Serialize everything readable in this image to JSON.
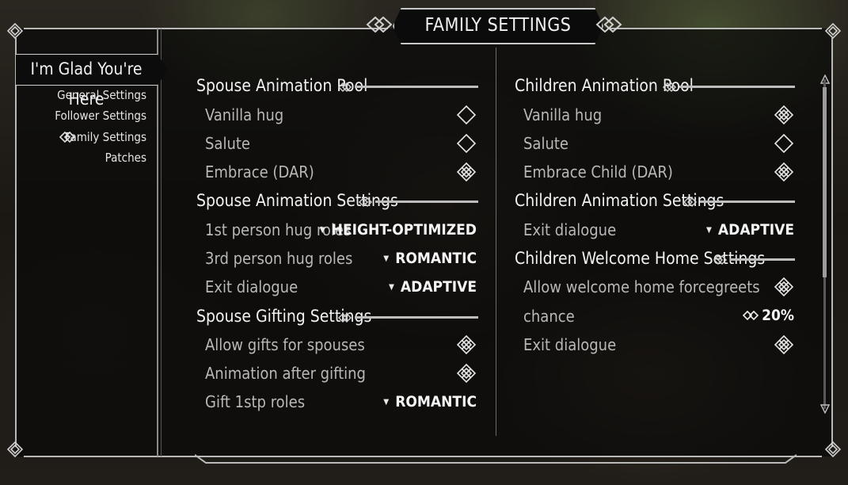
{
  "window": {
    "title": "FAMILY SETTINGS"
  },
  "sidebar": {
    "selected": "I'm Glad You're Here",
    "items": [
      {
        "label": "General Settings"
      },
      {
        "label": "Follower Settings"
      },
      {
        "label": "Family Settings",
        "icon": "celtic-knot-icon",
        "active": true
      },
      {
        "label": "Patches"
      }
    ]
  },
  "left": {
    "sections": [
      {
        "heading": "Spouse Animation Pool",
        "rows": [
          {
            "label": "Vanilla hug",
            "type": "toggle",
            "checked": false
          },
          {
            "label": "Salute",
            "type": "toggle",
            "checked": false
          },
          {
            "label": "Embrace (DAR)",
            "type": "toggle",
            "checked": true
          }
        ]
      },
      {
        "heading": "Spouse Animation Settings",
        "rows": [
          {
            "label": "1st person hug roles",
            "type": "menu",
            "value": "HEIGHT-OPTIMIZED"
          },
          {
            "label": "3rd person hug roles",
            "type": "menu",
            "value": "ROMANTIC"
          },
          {
            "label": "Exit dialogue",
            "type": "menu",
            "value": "ADAPTIVE"
          }
        ]
      },
      {
        "heading": "Spouse Gifting Settings",
        "rows": [
          {
            "label": "Allow gifts for spouses",
            "type": "toggle",
            "checked": true
          },
          {
            "label": "Animation after gifting",
            "type": "toggle",
            "checked": true
          },
          {
            "label": "Gift 1stp roles",
            "type": "menu",
            "value": "ROMANTIC"
          }
        ]
      }
    ]
  },
  "right": {
    "sections": [
      {
        "heading": "Children Animation Pool",
        "rows": [
          {
            "label": "Vanilla hug",
            "type": "toggle",
            "checked": true
          },
          {
            "label": "Salute",
            "type": "toggle",
            "checked": false
          },
          {
            "label": "Embrace Child (DAR)",
            "type": "toggle",
            "checked": true
          }
        ]
      },
      {
        "heading": "Children Animation Settings",
        "rows": [
          {
            "label": "Exit dialogue",
            "type": "menu",
            "value": "ADAPTIVE"
          }
        ]
      },
      {
        "heading": "Children Welcome Home Settings",
        "rows": [
          {
            "label": "Allow welcome home forcegreets",
            "type": "toggle",
            "checked": true
          },
          {
            "label": "chance",
            "type": "slider",
            "value": "20%"
          },
          {
            "label": "Exit dialogue",
            "type": "toggle",
            "checked": true
          }
        ]
      }
    ]
  },
  "colors": {
    "accent": "#f5f5f5",
    "muted": "#b8b8b8",
    "frame": "#b9b9b9"
  }
}
